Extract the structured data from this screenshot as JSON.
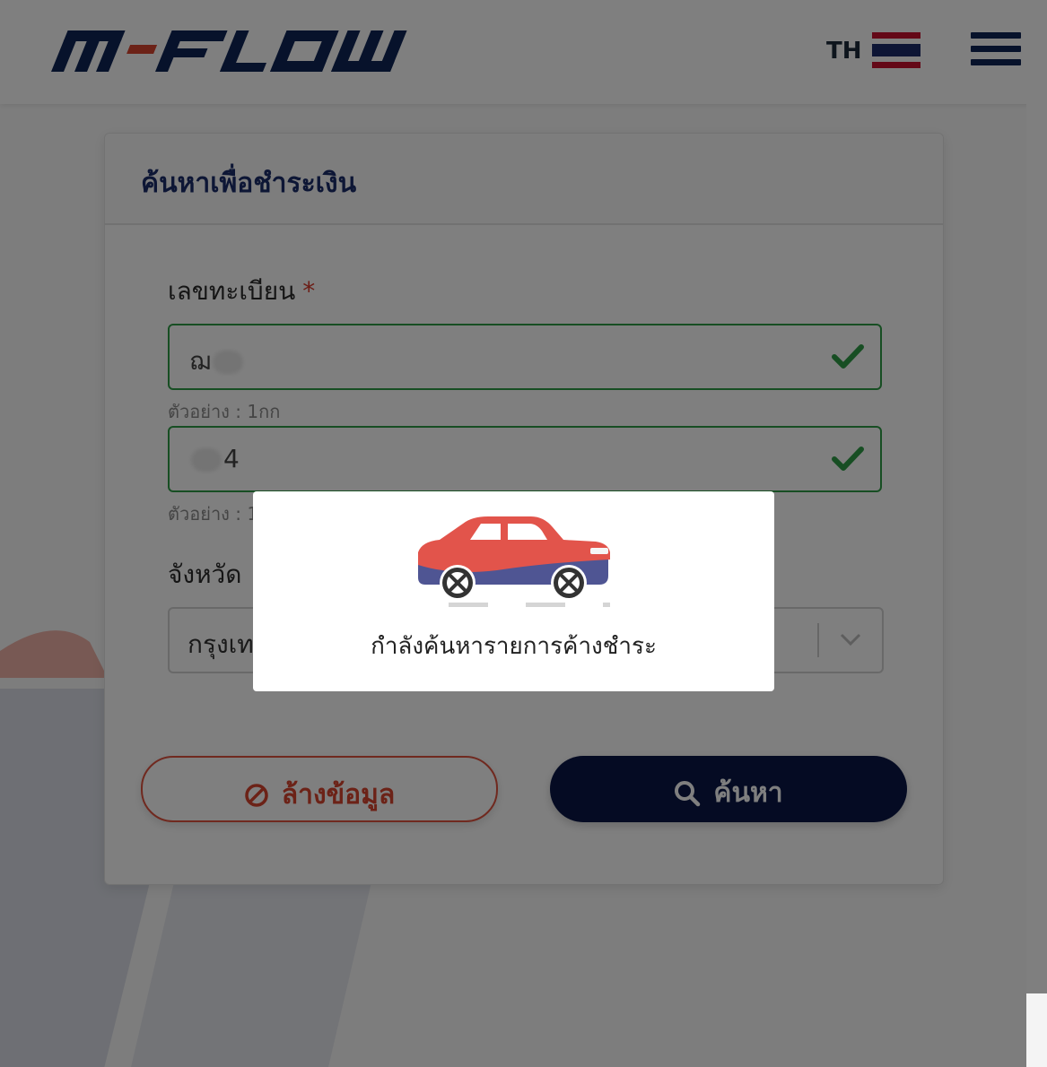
{
  "header": {
    "logo_text": "M-FLOW",
    "language": "TH",
    "flag": "thai-flag-icon",
    "menu": "hamburger-menu-icon"
  },
  "form": {
    "title": "ค้นหาเพื่อชำระเงิน",
    "plate_label": "เลขทะเบียน",
    "required_mark": "*",
    "plate_prefix_value": "ฌ",
    "plate_prefix_hint": "ตัวอย่าง : 1กก",
    "plate_number_value": "4",
    "plate_number_hint": "ตัวอย่าง : 1",
    "province_label": "จังหวัด",
    "province_value": "กรุงเท",
    "clear_button": "ล้างข้อมูล",
    "search_button": "ค้นหา"
  },
  "loading_modal": {
    "message": "กำลังค้นหารายการค้างชำระ",
    "icon": "car-loading-icon"
  },
  "colors": {
    "brand_navy": "#0f2557",
    "brand_red": "#d8452f",
    "valid_green": "#2e9d46",
    "overlay": "rgba(0,0,0,0.5)"
  }
}
